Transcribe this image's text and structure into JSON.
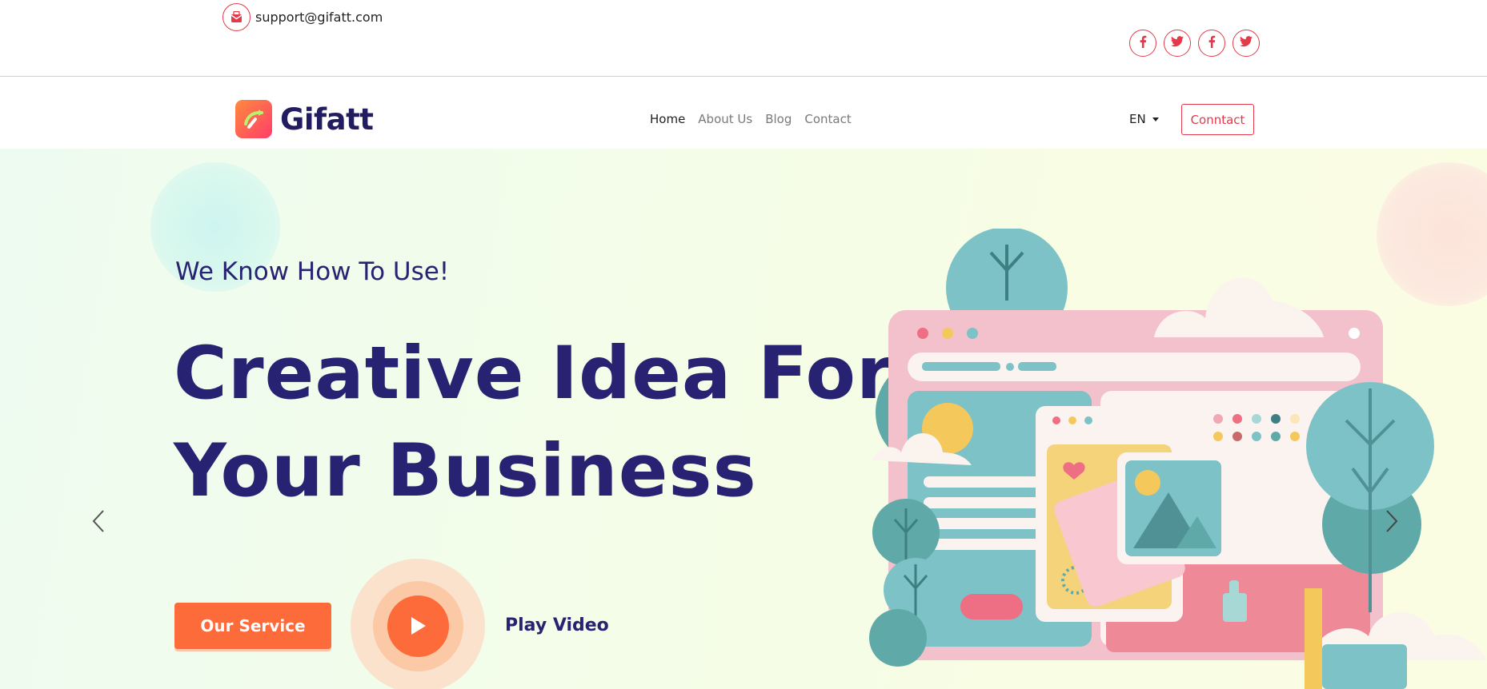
{
  "topbar": {
    "email": "support@gifatt.com",
    "socials": [
      {
        "icon": "facebook-icon"
      },
      {
        "icon": "twitter-icon"
      },
      {
        "icon": "facebook-icon"
      },
      {
        "icon": "twitter-icon"
      }
    ]
  },
  "nav": {
    "brand": "Gifatt",
    "menu": [
      {
        "label": "Home",
        "active": true
      },
      {
        "label": "About Us",
        "active": false
      },
      {
        "label": "Blog",
        "active": false
      },
      {
        "label": "Contact",
        "active": false
      }
    ],
    "language": "EN",
    "contact_button": "Conntact"
  },
  "hero": {
    "subhead": "We Know How To Use!",
    "headline_line1": "Creative Idea For",
    "headline_line2": "Your Business",
    "service_button": "Our Service",
    "play_label": "Play Video"
  },
  "colors": {
    "accent": "#e23a4b",
    "primary_text": "#272272",
    "cta": "#fe6b3a"
  }
}
